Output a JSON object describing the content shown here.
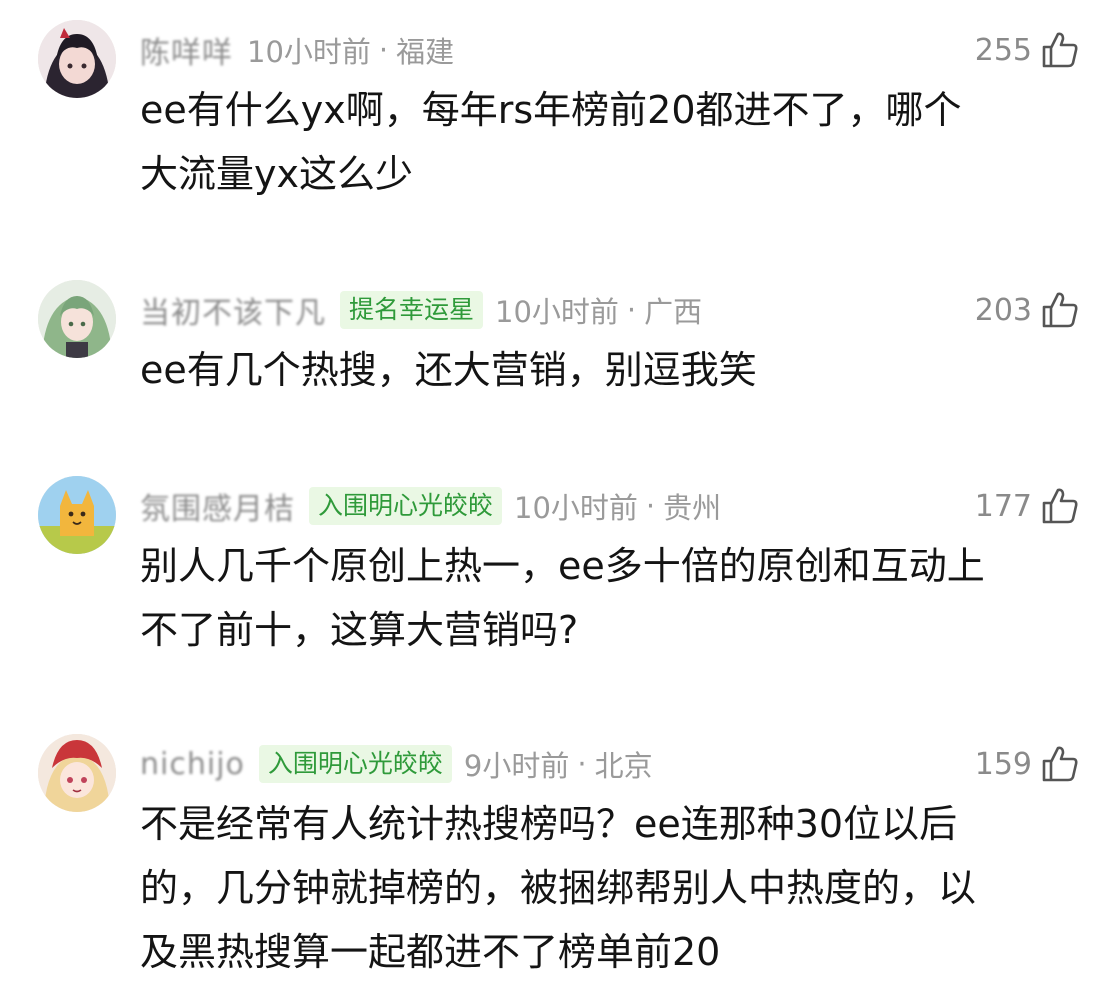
{
  "comments": [
    {
      "username": "陈咩咩",
      "badge": "",
      "time": "10小时前",
      "location": "福建",
      "likes": "255",
      "text": "ee有什么yx啊，每年rs年榜前20都进不了，哪个\n大流量yx这么少"
    },
    {
      "username": "当初不该下凡",
      "badge": "提名幸运星",
      "time": "10小时前",
      "location": "广西",
      "likes": "203",
      "text": "ee有几个热搜，还大营销，别逗我笑"
    },
    {
      "username": "氛围感月桔",
      "badge": "入围明心光皎皎",
      "time": "10小时前",
      "location": "贵州",
      "likes": "177",
      "text": "别人几千个原创上热一，ee多十倍的原创和互动上\n不了前十，这算大营销吗?"
    },
    {
      "username": "nichijo",
      "badge": "入围明心光皎皎",
      "time": "9小时前",
      "location": "北京",
      "likes": "159",
      "text": "不是经常有人统计热搜榜吗？ee连那种30位以后\n的，几分钟就掉榜的，被捆绑帮别人中热度的，以\n及黑热搜算一起都进不了榜单前20"
    }
  ],
  "dot": "·",
  "icons": {
    "like": "thumbs-up-icon"
  },
  "colors": {
    "badge_text": "#2f9a3a",
    "badge_bg": "#eaf8e4",
    "meta": "#9a9a9a"
  }
}
